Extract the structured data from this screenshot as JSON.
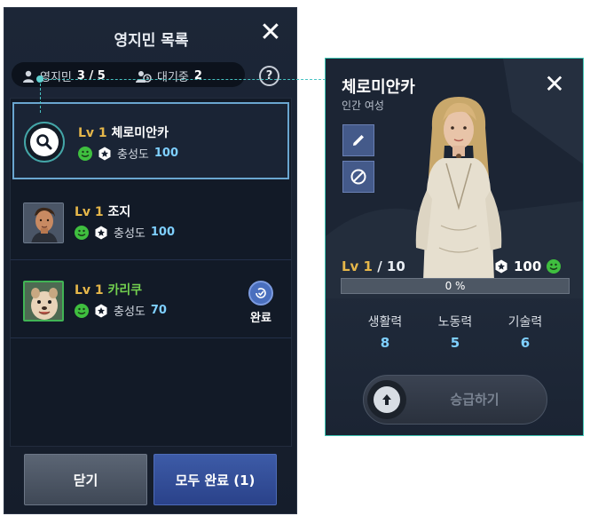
{
  "roster_panel": {
    "title": "영지민 목록",
    "close_icon": "close-icon",
    "residents_label": "영지민",
    "residents_count": "3 / 5",
    "waiting_label": "대기중",
    "waiting_count": "2",
    "help_label": "?",
    "loyalty_label": "충성도",
    "residents": [
      {
        "level": "Lv 1",
        "name": "체로미안카",
        "loyalty": "100",
        "selected": true,
        "status_icon": "search-icon"
      },
      {
        "level": "Lv 1",
        "name": "조지",
        "loyalty": "100",
        "selected": false
      },
      {
        "level": "Lv 1",
        "name": "카리쿠",
        "loyalty": "70",
        "selected": false,
        "done_label": "완료"
      }
    ],
    "close_button": "닫기",
    "complete_all_button": "모두 완료 (1)"
  },
  "detail_panel": {
    "name": "체로미안카",
    "subtitle": "인간 여성",
    "level_prefix": "Lv 1",
    "level_suffix": "/ 10",
    "loyalty": "100",
    "xp_percent_value": 0,
    "xp_text": "0 %",
    "stats": [
      {
        "label": "생활력",
        "value": "8"
      },
      {
        "label": "노동력",
        "value": "5"
      },
      {
        "label": "기술력",
        "value": "6"
      }
    ],
    "promote_button": "승급하기"
  },
  "colors": {
    "accent_teal": "#3cc4b2",
    "level_gold": "#e6b74a",
    "value_blue": "#7fd0ff",
    "name_green": "#73d04f",
    "primary_button": "#2a428a"
  }
}
